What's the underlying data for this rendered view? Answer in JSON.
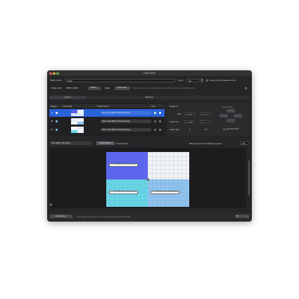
{
  "window": {
    "title": "Edit cube"
  },
  "stage": {
    "name_label": "Stage name:",
    "name_value": "cube",
    "layer_label": "Layer:",
    "layer_value": "top",
    "keep_rendering_label": "Keep rendering between cues",
    "size_label": "Stage size:",
    "size_value": "3456 × 2234",
    "retina_button": "Retina…",
    "mask_label": "Mask:",
    "load_mask_button": "Load mask…",
    "mask_hint": "Render pixels in the mask image will make the stage more transparent."
  },
  "tabs": [
    {
      "label": "Layout"
    },
    {
      "label": "Warping"
    }
  ],
  "table": {
    "headers": {
      "region": "Region",
      "thumbnail": "Thumbnail",
      "output": "Output Route",
      "grid": "Grid"
    },
    "rows": [
      {
        "letter": "A",
        "output": "Main output (Built-in Retina Display)",
        "selected": true
      },
      {
        "letter": "B",
        "output": "Main output (Built-in Retina Display)",
        "selected": false
      },
      {
        "letter": "C",
        "output": "Main output (Built-in Retina Display)",
        "selected": false
      }
    ]
  },
  "region_panel": {
    "title": "Region A",
    "edge_blends_label": "Edge blends",
    "size_label": "Size",
    "size_w": "1,728",
    "size_h": "1,117",
    "lower_left_label": "Lower left",
    "lower_left_x": "-1,728",
    "lower_left_y": "0",
    "upper_right_label": "Upper right",
    "upper_right_x": "0",
    "upper_right_y": "???",
    "auto_edge_blends_label": "Auto edge blends"
  },
  "toolbar": {
    "new_region_button": "New region with output…",
    "move_regions_button": "Move Regions",
    "draw_regions_label": "Draw Regions",
    "blend_gamma_label": "Blend gamma for overlapping regions:",
    "blend_gamma_value": "0.6"
  },
  "preview": {
    "labels": [
      "A: 1 Main output (Built-in Retina Display)",
      "C: 1 Main output (Built-in Retina Display)",
      "B: 1 Main output (Built-in Retina Display)"
    ]
  },
  "bottom": {
    "help_label": "?",
    "grid_options_button": "Grid options…",
    "guides_label": "Show alignment guides on all output routes used by this stage",
    "zoom_value": "Fit"
  },
  "colors": {
    "accent": "#2a62d9",
    "region_a": "#5a63f0",
    "region_b": "#8fc3ef",
    "region_c": "#66d6e6"
  }
}
